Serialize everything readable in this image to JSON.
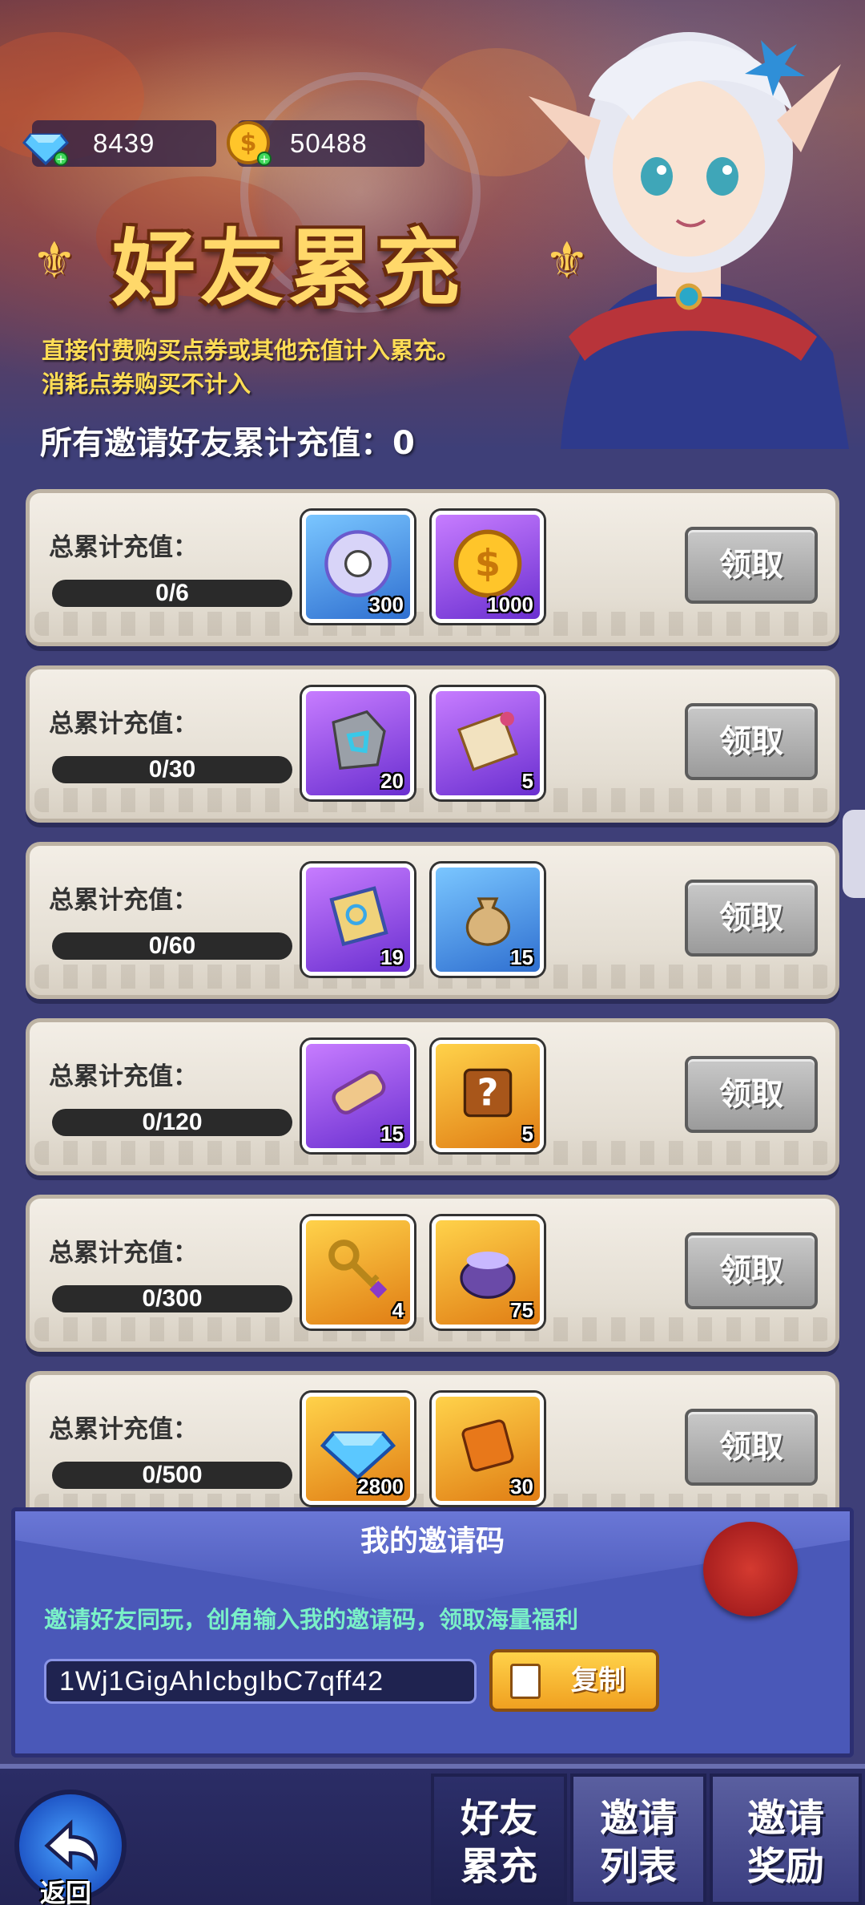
{
  "currency": {
    "gems": "8439",
    "coins": "50488"
  },
  "title": "好友累充",
  "description_line1": "直接付费购买点券或其他充值计入累充。",
  "description_line2": "消耗点券购买不计入",
  "total_label": "所有邀请好友累计充值：0",
  "rows": [
    {
      "label": "总累计充值：",
      "progress": "0/6",
      "items": [
        {
          "icon": "saw-disc-icon",
          "color": "blue",
          "qty": "300"
        },
        {
          "icon": "gold-coin-icon",
          "color": "purple",
          "qty": "1000"
        }
      ],
      "claim": "领取"
    },
    {
      "label": "总累计充值：",
      "progress": "0/30",
      "items": [
        {
          "icon": "rune-stone-icon",
          "color": "purple",
          "qty": "20"
        },
        {
          "icon": "scroll-icon",
          "color": "purple",
          "qty": "5"
        }
      ],
      "claim": "领取"
    },
    {
      "label": "总累计充值：",
      "progress": "0/60",
      "items": [
        {
          "icon": "blue-scroll-icon",
          "color": "purple",
          "qty": "19"
        },
        {
          "icon": "sack-icon",
          "color": "blue",
          "qty": "15"
        }
      ],
      "claim": "领取"
    },
    {
      "label": "总累计充值：",
      "progress": "0/120",
      "items": [
        {
          "icon": "ornate-scroll-icon",
          "color": "purple",
          "qty": "15"
        },
        {
          "icon": "mystery-puzzle-icon",
          "color": "gold",
          "qty": "5"
        }
      ],
      "claim": "领取"
    },
    {
      "label": "总累计充值：",
      "progress": "0/300",
      "items": [
        {
          "icon": "key-icon",
          "color": "gold",
          "qty": "4"
        },
        {
          "icon": "dust-pot-icon",
          "color": "gold",
          "qty": "75"
        }
      ],
      "claim": "领取"
    },
    {
      "label": "总累计充值：",
      "progress": "0/500",
      "items": [
        {
          "icon": "diamond-icon",
          "color": "gold",
          "qty": "2800"
        },
        {
          "icon": "puzzle-piece-icon",
          "color": "gold",
          "qty": "30"
        }
      ],
      "claim": "领取"
    }
  ],
  "invite": {
    "title": "我的邀请码",
    "message": "邀请好友同玩，创角输入我的邀请码，领取海量福利",
    "code": "1Wj1GigAhIcbgIbC7qff42",
    "copy": "复制"
  },
  "nav": {
    "back": "返回",
    "tab1_l1": "好友",
    "tab1_l2": "累充",
    "tab2_l1": "邀请",
    "tab2_l2": "列表",
    "tab3_l1": "邀请",
    "tab3_l2": "奖励"
  },
  "colors": {
    "accent_gold": "#ffd86a",
    "panel_bg": "#3e3f78",
    "invite_text": "#7af0c8"
  }
}
